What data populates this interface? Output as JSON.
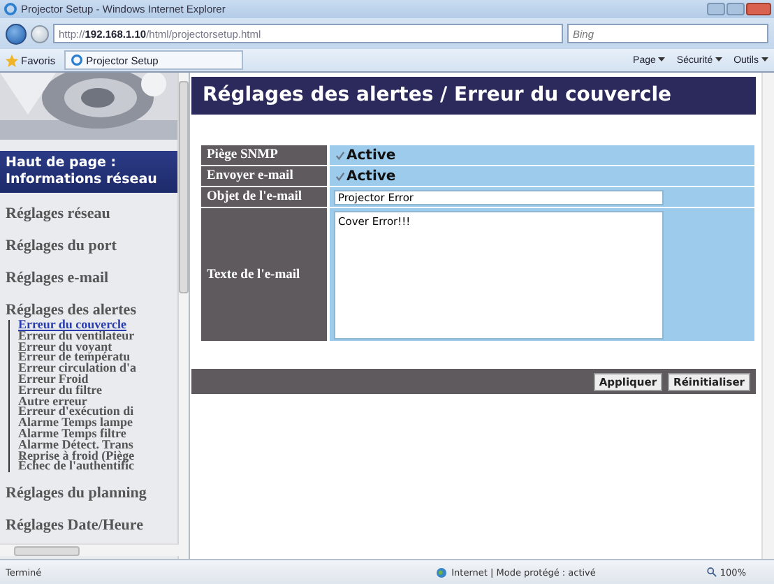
{
  "window": {
    "title": "Projector Setup - Windows Internet Explorer"
  },
  "address_bar": {
    "url_prefix": "http://",
    "url_host": "192.168.1.10",
    "url_path": "/html/projectorsetup.html"
  },
  "search": {
    "placeholder": "Bing"
  },
  "favorites_bar": {
    "favorites": "Favoris",
    "tab": "Projector Setup",
    "commands": [
      "Page",
      "Sécurité",
      "Outils"
    ]
  },
  "sidebar": {
    "header": "Haut de page : Informations réseau",
    "items": [
      {
        "label": "Réglages réseau"
      },
      {
        "label": "Réglages du port"
      },
      {
        "label": "Réglages e-mail"
      },
      {
        "label": "Réglages des alertes",
        "children": [
          {
            "label": "Erreur du couvercle",
            "selected": true
          },
          {
            "label": "Erreur du ventilateur",
            "selected": false
          },
          {
            "label": "Erreur du voyant",
            "selected": false
          },
          {
            "label": "Erreur de températu",
            "selected": false
          },
          {
            "label": "Erreur circulation d'a",
            "selected": false
          },
          {
            "label": "Erreur Froid",
            "selected": false
          },
          {
            "label": "Erreur du filtre",
            "selected": false
          },
          {
            "label": "Autre erreur",
            "selected": false
          },
          {
            "label": "Erreur d'exécution di",
            "selected": false
          },
          {
            "label": "Alarme Temps lampe",
            "selected": false
          },
          {
            "label": "Alarme Temps filtre",
            "selected": false
          },
          {
            "label": "Alarme Détect. Trans",
            "selected": false
          },
          {
            "label": "Reprise à froid (Piège",
            "selected": false
          },
          {
            "label": "Échec de l'authentific",
            "selected": false
          }
        ]
      },
      {
        "label": "Réglages du planning"
      },
      {
        "label": "Réglages Date/Heure"
      }
    ]
  },
  "page": {
    "title": "Réglages des alertes / Erreur du couvercle",
    "form": [
      {
        "kind": "checkbox",
        "label": "Piège SNMP",
        "text": "Active",
        "checked": true
      },
      {
        "kind": "checkbox",
        "label": "Envoyer e-mail",
        "text": "Active",
        "checked": true
      },
      {
        "kind": "input",
        "label": "Objet de l'e-mail",
        "value": "Projector Error"
      },
      {
        "kind": "textarea",
        "label": "Texte de l'e-mail",
        "value": "Cover Error!!!"
      }
    ],
    "buttons": [
      "Appliquer",
      "Réinitialiser"
    ]
  },
  "status_bar": {
    "status": "Terminé",
    "zone": "Internet | Mode protégé : activé",
    "zoom": "100%"
  }
}
